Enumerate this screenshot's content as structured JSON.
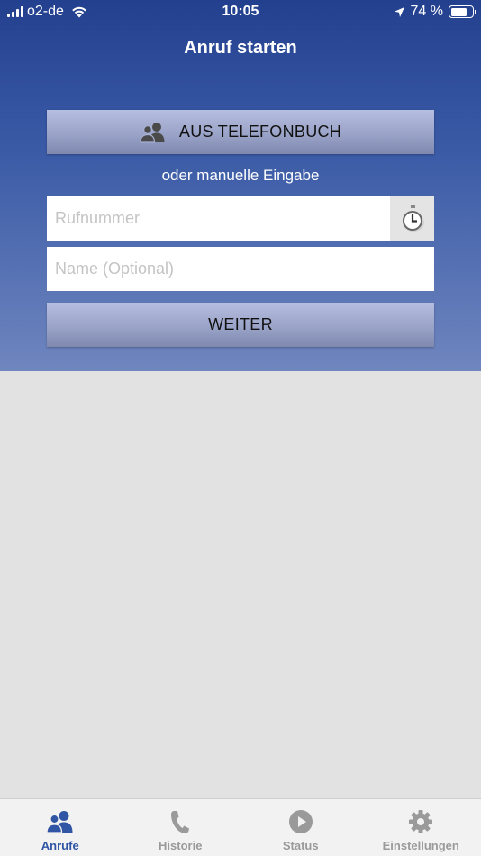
{
  "status_bar": {
    "carrier": "o2-de",
    "time": "10:05",
    "battery": "74 %",
    "battery_level": 0.74
  },
  "header": {
    "title": "Anruf starten"
  },
  "phonebook_button": {
    "label": "AUS TELEFONBUCH",
    "icon": "users-icon"
  },
  "manual_entry": {
    "label": "oder manuelle Eingabe"
  },
  "phone_field": {
    "placeholder": "Rufnummer",
    "value": "",
    "icon": "clock-history-icon"
  },
  "name_field": {
    "placeholder": "Name (Optional)",
    "value": ""
  },
  "next_button": {
    "label": "WEITER"
  },
  "tabbar": {
    "active_color": "#2f55a4",
    "inactive_color": "#9a9a9a",
    "tabs": [
      {
        "label": "Anrufe",
        "icon": "users-icon",
        "active": true
      },
      {
        "label": "Historie",
        "icon": "phone-icon",
        "active": false
      },
      {
        "label": "Status",
        "icon": "play-circle-icon",
        "active": false
      },
      {
        "label": "Einstellungen",
        "icon": "gear-icon",
        "active": false
      }
    ]
  }
}
